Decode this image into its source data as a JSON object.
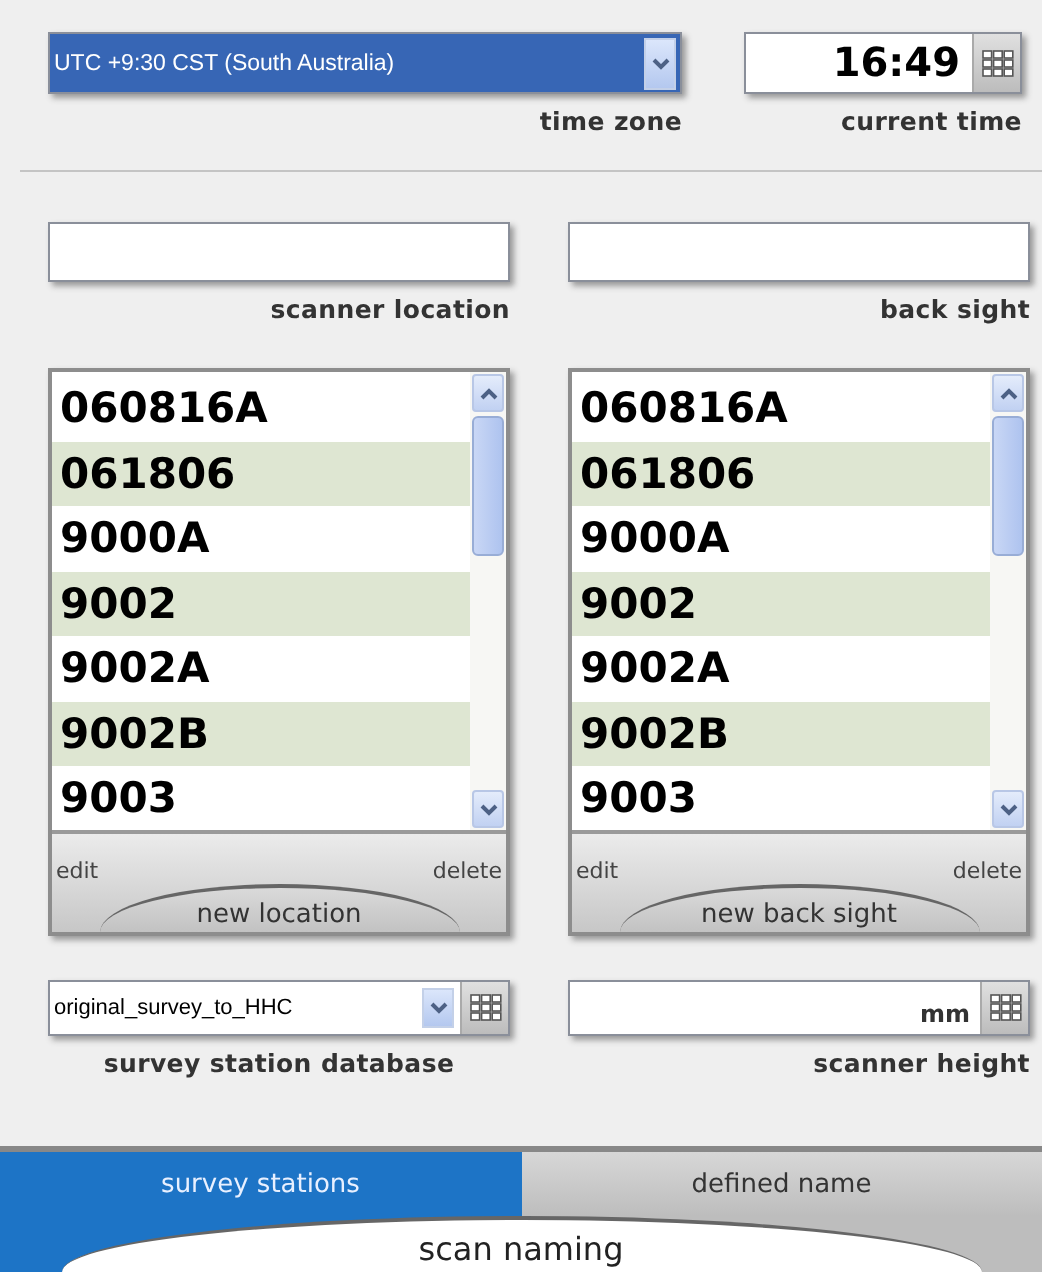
{
  "time_zone": {
    "value": "UTC +9:30 CST (South Australia)",
    "label": "time zone"
  },
  "current_time": {
    "value": "16:49",
    "label": "current time"
  },
  "scanner_location": {
    "label": "scanner location"
  },
  "back_sight": {
    "label": "back sight"
  },
  "lists": [
    {
      "items": [
        "060816A",
        "061806",
        "9000A",
        "9002",
        "9002A",
        "9002B",
        "9003"
      ],
      "edit": "edit",
      "delete": "delete",
      "add": "new location"
    },
    {
      "items": [
        "060816A",
        "061806",
        "9000A",
        "9002",
        "9002A",
        "9002B",
        "9003"
      ],
      "edit": "edit",
      "delete": "delete",
      "add": "new back sight"
    }
  ],
  "database": {
    "value": "original_survey_to_HHC",
    "label": "survey station database"
  },
  "scanner_height": {
    "unit": "mm",
    "label": "scanner height"
  },
  "tabs": [
    {
      "label": "survey stations",
      "selected": true
    },
    {
      "label": "defined name",
      "selected": false
    }
  ],
  "footer_title": "scan naming"
}
